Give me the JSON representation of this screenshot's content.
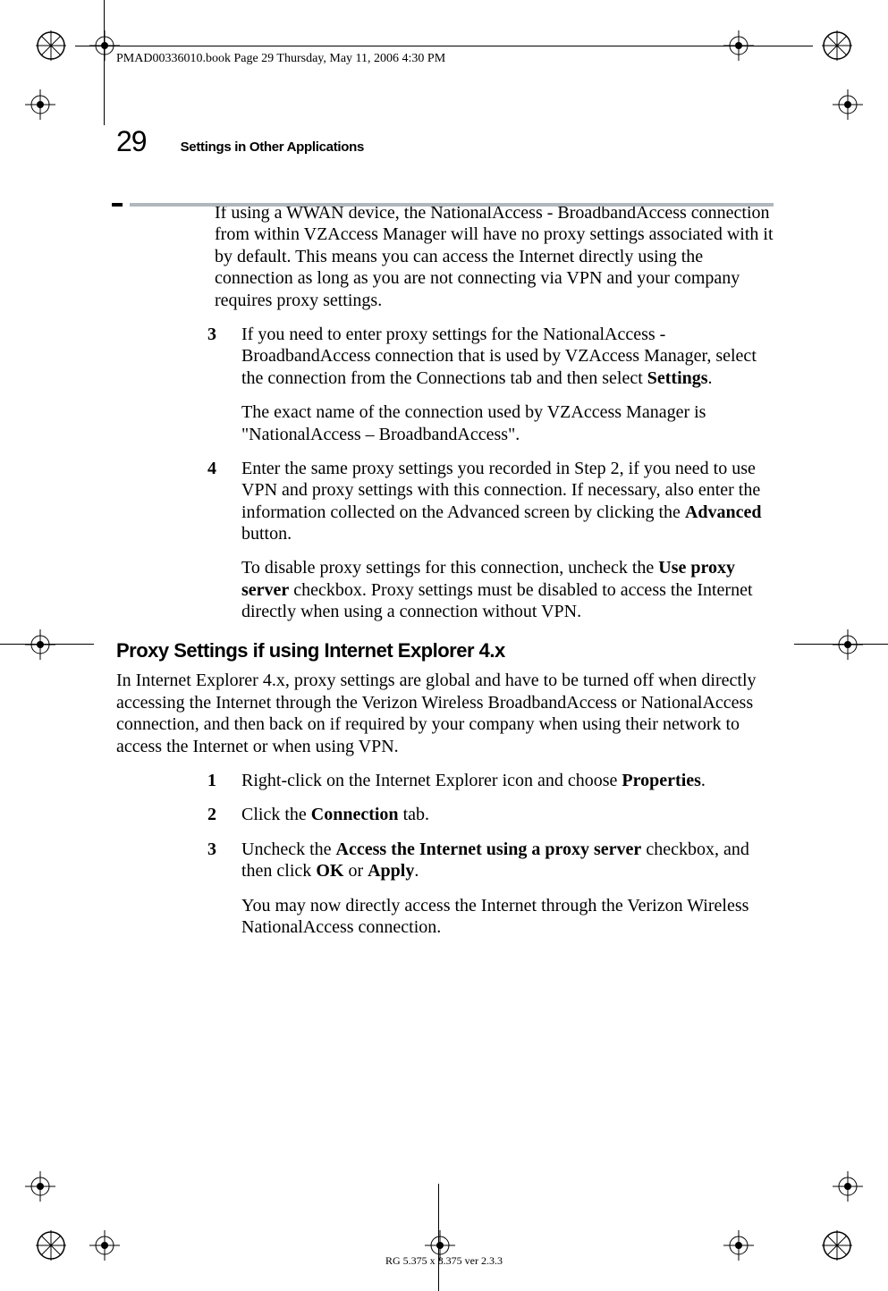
{
  "header": {
    "running_text": "PMAD00336010.book  Page 29  Thursday, May 11, 2006  4:30 PM"
  },
  "page": {
    "number": "29",
    "section": "Settings in Other Applications"
  },
  "content": {
    "intro": "If using a WWAN device, the NationalAccess - BroadbandAccess connection from within VZAccess Manager will have no proxy settings associated with it by default. This means you can access the Internet directly using the connection as long as you are not connecting via VPN and your company requires proxy settings.",
    "step3_num": "3",
    "step3a": "If you need to enter proxy settings for the NationalAccess - BroadbandAccess connection that is used by VZAccess Manager, select the connection from the Connections tab and then select ",
    "step3a_bold": "Settings",
    "step3a_end": ".",
    "step3_note": "The exact name of the connection used by VZAccess Manager is \"NationalAccess – BroadbandAccess\".",
    "step4_num": "4",
    "step4a": "Enter the same proxy settings you recorded in Step 2, if you need to use VPN and proxy settings with this connection. If necessary, also enter the information collected on the Advanced screen by clicking the ",
    "step4a_bold": "Advanced",
    "step4a_end": " button.",
    "step4_note_a": "To disable proxy settings for this connection, uncheck the ",
    "step4_note_bold": "Use proxy server",
    "step4_note_b": " checkbox. Proxy settings must be disabled to access the Internet directly when using a connection without VPN.",
    "subhead": "Proxy Settings if using Internet Explorer 4.x",
    "ie4_intro": "In Internet Explorer 4.x, proxy settings are global and have to be turned off when directly accessing the Internet through the Verizon Wireless BroadbandAccess or NationalAccess connection, and then back on if required by your company when using their network to access the Internet or when using VPN.",
    "ie4_s1_num": "1",
    "ie4_s1_a": "Right-click on the Internet Explorer icon and choose ",
    "ie4_s1_bold": "Properties",
    "ie4_s1_end": ".",
    "ie4_s2_num": "2",
    "ie4_s2_a": "Click the ",
    "ie4_s2_bold": "Connection",
    "ie4_s2_end": " tab.",
    "ie4_s3_num": "3",
    "ie4_s3_a": "Uncheck the ",
    "ie4_s3_bold": "Access the Internet using a proxy server",
    "ie4_s3_b": " checkbox, and then click ",
    "ie4_s3_bold2": "OK",
    "ie4_s3_c": " or ",
    "ie4_s3_bold3": "Apply",
    "ie4_s3_end": ".",
    "ie4_s3_note": "You may now directly access the Internet through the Verizon Wireless NationalAccess connection."
  },
  "footer": {
    "text": "RG 5.375 x 8.375 ver 2.3.3"
  }
}
